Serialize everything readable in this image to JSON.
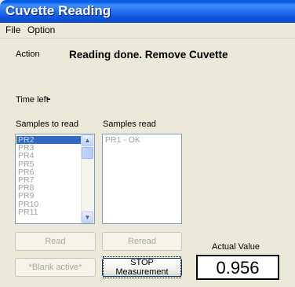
{
  "window": {
    "title": "Cuvette Reading"
  },
  "menu": {
    "items": [
      "File",
      "Option"
    ]
  },
  "action": {
    "label": "Action",
    "status": "Reading done. Remove Cuvette"
  },
  "time_left": {
    "label": "Time left",
    "value": "-"
  },
  "samples_to_read": {
    "label": "Samples to read",
    "items": [
      "PR2",
      "PR3",
      "PR4",
      "PR5",
      "PR6",
      "PR7",
      "PR8",
      "PR9",
      "PR10",
      "PR11"
    ],
    "selected_index": 0
  },
  "samples_read": {
    "label": "Samples read",
    "items": [
      "PR1 - OK"
    ]
  },
  "buttons": {
    "read": "Read",
    "reread": "Reread",
    "blank_active": "*Blank active*",
    "stop": "STOP Measurement"
  },
  "actual_value": {
    "label": "Actual Value",
    "value": "0.956"
  }
}
